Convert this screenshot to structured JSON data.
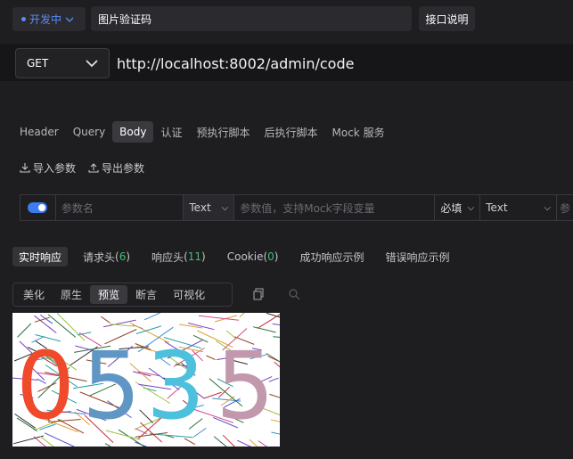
{
  "header": {
    "status": "开发中",
    "api_name": "图片验证码",
    "doc_button": "接口说明"
  },
  "request": {
    "method": "GET",
    "url": "http://localhost:8002/admin/code"
  },
  "tabs": [
    "Header",
    "Query",
    "Body",
    "认证",
    "预执行脚本",
    "后执行脚本",
    "Mock 服务"
  ],
  "active_tab": "Body",
  "import_actions": {
    "import": "导入参数",
    "export": "导出参数"
  },
  "param_row": {
    "name_placeholder": "参数名",
    "type": "Text",
    "value_placeholder": "参数值，支持Mock字段变量",
    "required": "必填",
    "content_type": "Text",
    "desc_placeholder": "参"
  },
  "response_tabs": [
    {
      "label": "实时响应",
      "count": ""
    },
    {
      "label": "请求头",
      "count": "6"
    },
    {
      "label": "响应头",
      "count": "11"
    },
    {
      "label": "Cookie",
      "count": "0"
    },
    {
      "label": "成功响应示例",
      "count": ""
    },
    {
      "label": "错误响应示例",
      "count": ""
    }
  ],
  "view_modes": [
    "美化",
    "原生",
    "预览",
    "断言",
    "可视化"
  ],
  "active_view": "预览",
  "captcha": {
    "text": "0535",
    "digit_colors": [
      "#ef4a2c",
      "#5f96c4",
      "#4cc0dc",
      "#c298ad"
    ]
  },
  "colors": {
    "accent": "#3c7bf0",
    "count_green": "#3fbf6f",
    "status_blue": "#5a8df0"
  }
}
